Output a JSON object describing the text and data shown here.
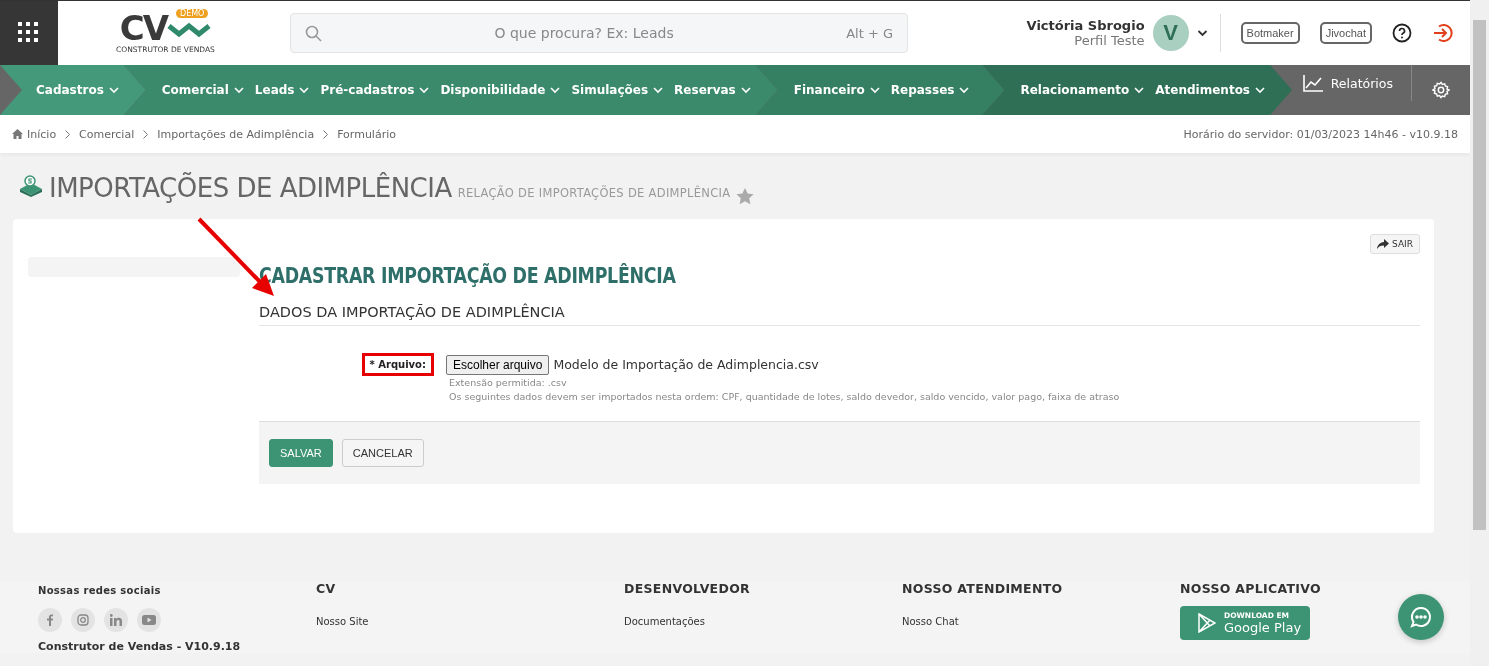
{
  "header": {
    "logo": {
      "mark": "CV",
      "badge": "DEMO",
      "tagline": "CONSTRUTOR DE VENDAS"
    },
    "search": {
      "placeholder": "O que procura? Ex: Leads",
      "shortcut": "Alt + G"
    },
    "user": {
      "name": "Victória Sbrogio",
      "profile": "Perfil Teste",
      "initial": "V"
    },
    "buttons": [
      "Botmaker",
      "Jivochat"
    ]
  },
  "nav": {
    "groups": [
      {
        "color": "#43997a",
        "items": [
          "Cadastros"
        ]
      },
      {
        "color": "#3a8a6b",
        "items": [
          "Comercial",
          "Leads",
          "Pré-cadastros",
          "Disponibilidade",
          "Simulações",
          "Reservas"
        ]
      },
      {
        "color": "#357f62",
        "items": [
          "Financeiro",
          "Repasses"
        ]
      },
      {
        "color": "#2f6f55",
        "items": [
          "Relacionamento",
          "Atendimentos"
        ]
      }
    ],
    "reports": "Relatórios"
  },
  "breadcrumb": [
    "Início",
    "Comercial",
    "Importações de Adimplência",
    "Formulário"
  ],
  "server_time": "Horário do servidor: 01/03/2023 14h46 - v10.9.18",
  "page": {
    "title": "IMPORTAÇÕES DE ADIMPLÊNCIA",
    "subtitle": "RELAÇÃO DE IMPORTAÇÕES DE ADIMPLÊNCIA",
    "favorite": false
  },
  "form": {
    "exit": "SAIR",
    "title": "CADASTRAR IMPORTAÇÃO DE ADIMPLÊNCIA",
    "section": "DADOS DA IMPORTAÇÃO DE ADIMPLÊNCIA",
    "field": {
      "required": "*",
      "label": "Arquivo:",
      "button": "Escolher arquivo",
      "value": "Modelo de Importação de Adimplencia.csv",
      "highlighted": true
    },
    "hints": [
      "Extensão permitida: .csv",
      "Os seguintes dados devem ser importados nesta ordem: CPF, quantidade de lotes, saldo devedor, saldo vencido, valor pago, faixa de atraso"
    ],
    "buttons": [
      {
        "label": "SALVAR",
        "kind": "primary"
      },
      {
        "label": "CANCELAR",
        "kind": "default"
      }
    ]
  },
  "footer": {
    "social": {
      "title": "Nossas redes sociais",
      "brand": "Construtor de Vendas - V10.9.18"
    },
    "columns": [
      {
        "title": "CV",
        "links": [
          "Nosso Site"
        ]
      },
      {
        "title": "DESENVOLVEDOR",
        "links": [
          "Documentações"
        ]
      },
      {
        "title": "NOSSO ATENDIMENTO",
        "links": [
          "Nosso Chat"
        ]
      }
    ],
    "app": {
      "title": "NOSSO APLICATIVO",
      "store_small": "DOWNLOAD EM",
      "store": "Google Play"
    }
  }
}
